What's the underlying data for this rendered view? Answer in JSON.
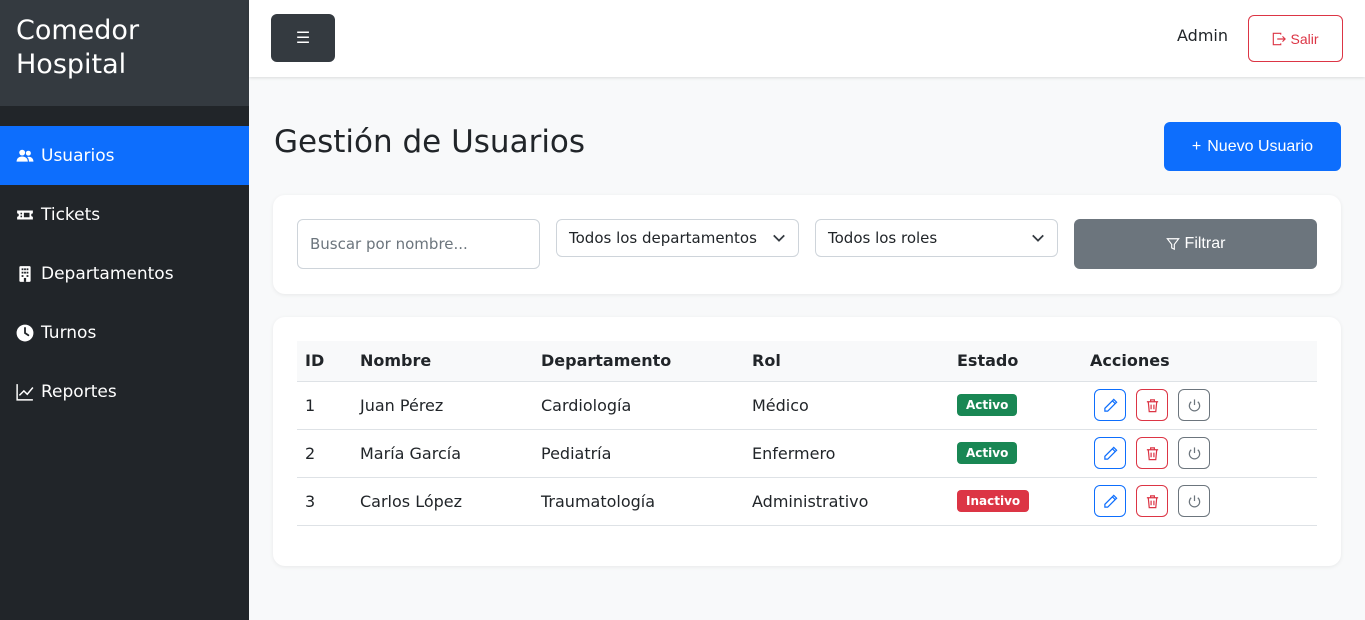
{
  "sidebar": {
    "brand": "Comedor Hospital",
    "items": [
      {
        "label": "Usuarios",
        "icon": "users-icon",
        "active": true
      },
      {
        "label": "Tickets",
        "icon": "ticket-icon",
        "active": false
      },
      {
        "label": "Departamentos",
        "icon": "building-icon",
        "active": false
      },
      {
        "label": "Turnos",
        "icon": "clock-icon",
        "active": false
      },
      {
        "label": "Reportes",
        "icon": "chart-icon",
        "active": false
      }
    ]
  },
  "topbar": {
    "menu_icon": "☰",
    "user": "Admin",
    "logout_label": "Salir"
  },
  "main": {
    "title": "Gestión de Usuarios",
    "new_button": "Nuevo Usuario",
    "new_button_icon": "+"
  },
  "filters": {
    "search_placeholder": "Buscar por nombre...",
    "department_selected": "Todos los departamentos",
    "role_selected": "Todos los roles",
    "filter_button": "Filtrar"
  },
  "table": {
    "headers": [
      "ID",
      "Nombre",
      "Departamento",
      "Rol",
      "Estado",
      "Acciones"
    ],
    "rows": [
      {
        "id": "1",
        "nombre": "Juan Pérez",
        "departamento": "Cardiología",
        "rol": "Médico",
        "estado": "Activo",
        "estado_color": "#198754"
      },
      {
        "id": "2",
        "nombre": "María García",
        "departamento": "Pediatría",
        "rol": "Enfermero",
        "estado": "Activo",
        "estado_color": "#198754"
      },
      {
        "id": "3",
        "nombre": "Carlos López",
        "departamento": "Traumatología",
        "rol": "Administrativo",
        "estado": "Inactivo",
        "estado_color": "#dc3545"
      }
    ]
  },
  "colors": {
    "primary": "#0d6efd",
    "danger": "#dc3545",
    "success": "#198754",
    "secondary": "#6c757d",
    "sidebar_bg": "#212529"
  }
}
